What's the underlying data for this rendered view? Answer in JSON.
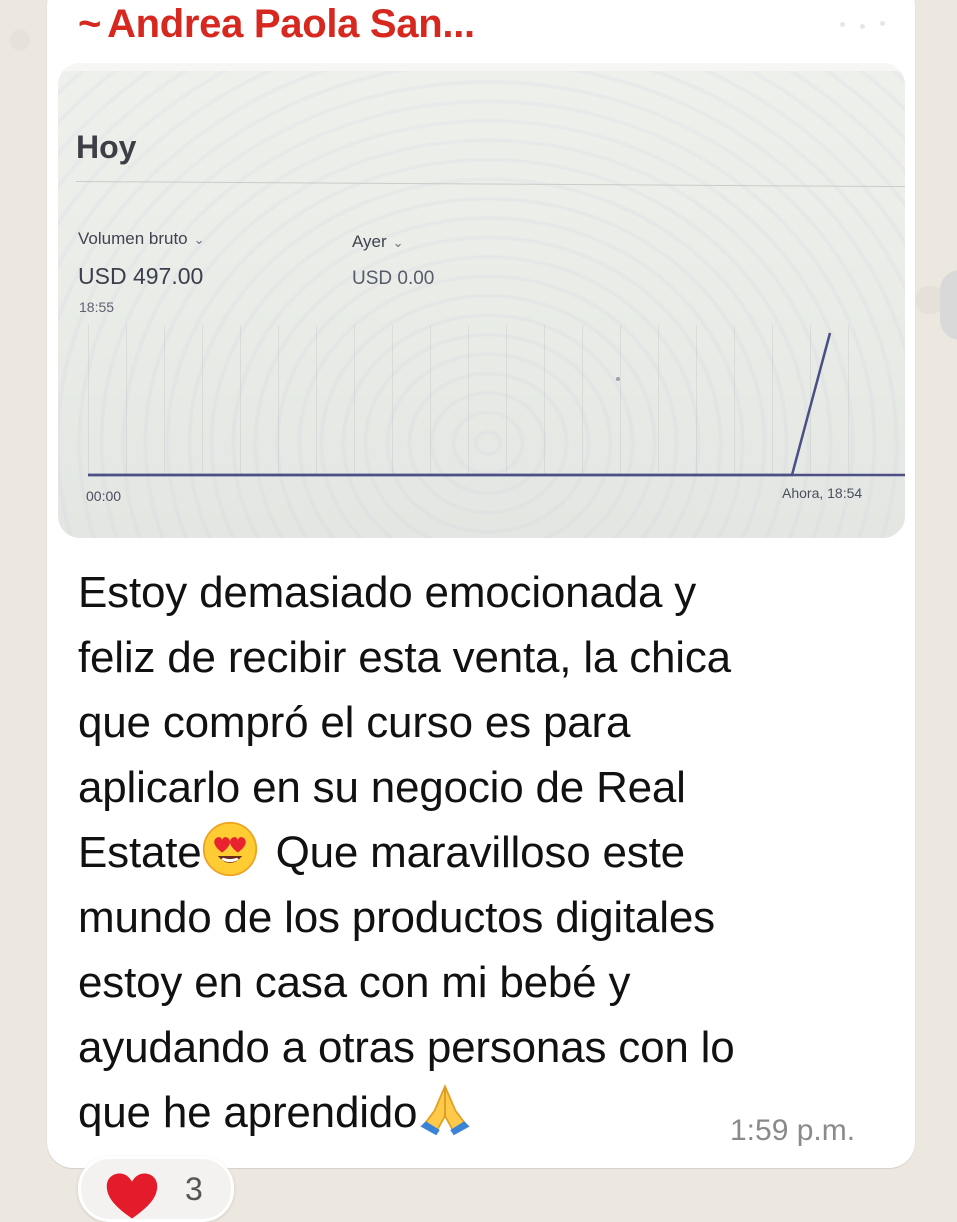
{
  "message": {
    "sender": "Andrea Paola San...",
    "sender_prefix": "~",
    "sender_color": "#d6281f",
    "text_line_1": "Estoy demasiado emocionada y",
    "text_line_2": "feliz de recibir esta venta, la chica",
    "text_line_3": "que compró el curso es para",
    "text_line_4": "aplicarlo en su negocio de Real",
    "text_line_5_a": "Estate",
    "emoji_1": "smiling-face-with-heart-eyes",
    "text_line_5_b": " Que maravilloso este",
    "text_line_6": "mundo de los productos digitales",
    "text_line_7": "estoy en casa con mi bebé y",
    "text_line_8": "ayudando a otras personas con lo",
    "text_line_9": "que he aprendido",
    "emoji_2": "folded-hands",
    "time": "1:59 p.m.",
    "reaction": {
      "emoji": "red-heart",
      "count": "3"
    }
  },
  "screenshot": {
    "heading": "Hoy",
    "metric_1": {
      "label": "Volumen bruto",
      "value": "USD 497.00",
      "time": "18:55"
    },
    "metric_2": {
      "label": "Ayer",
      "value": "USD 0.00"
    },
    "chart_data": {
      "type": "line",
      "x_start_label": "00:00",
      "x_end_label": "Ahora, 18:54",
      "series": [
        {
          "x": [
            "00:00",
            "18:30",
            "18:54"
          ],
          "values": [
            0,
            0,
            497
          ]
        }
      ],
      "line_color": "#3a3f7a"
    }
  }
}
